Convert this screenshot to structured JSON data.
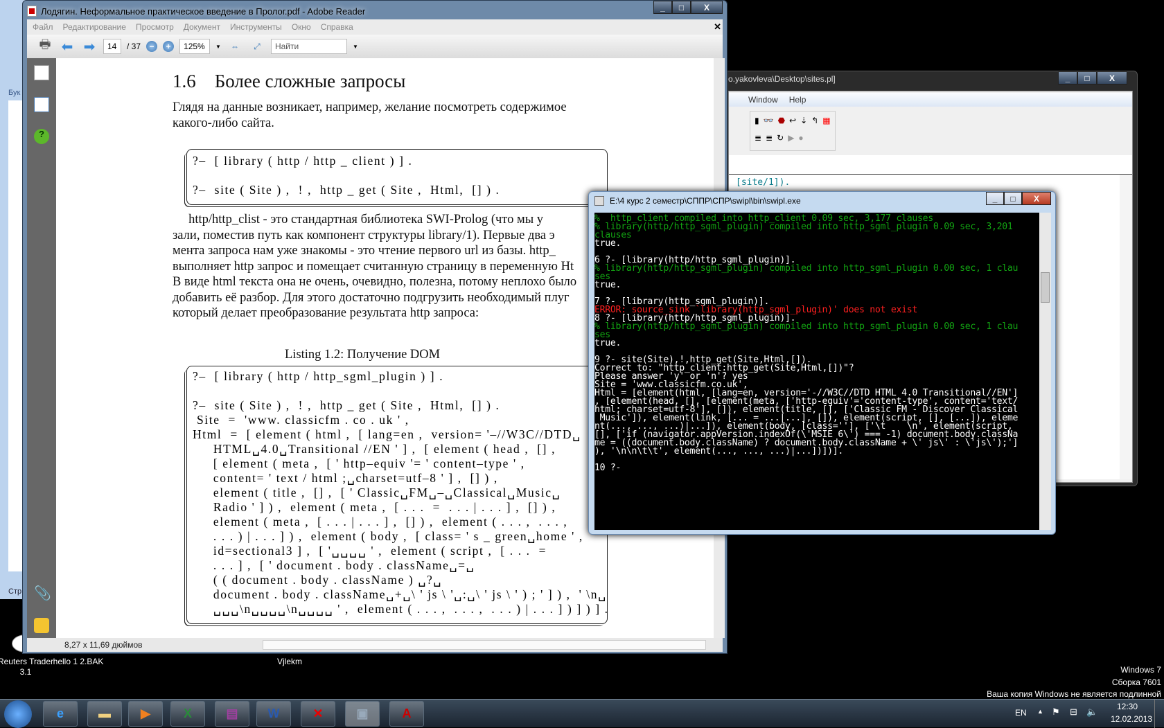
{
  "adobe": {
    "title": "Лодягин. Неформальное практическое введение в Пролог.pdf - Adobe Reader",
    "menu": [
      "Файл",
      "Редактирование",
      "Просмотр",
      "Документ",
      "Инструменты",
      "Окно",
      "Справка"
    ],
    "page": "14",
    "page_total": "/ 37",
    "zoom": "125%",
    "find_placeholder": "Найти",
    "status": "8,27 x 11,69 дюймов"
  },
  "pdf": {
    "heading": "1.6    Более сложные запросы",
    "para1": [
      "Глядя на данные возникает, например, желание посмотреть содержимое",
      "какого-либо сайта."
    ],
    "code1": [
      "?–  [ library ( http / http _ client ) ] .",
      "",
      "?–  site ( Site ) ,  ! ,  http _ get ( Site ,  Html,  [] ) ."
    ],
    "para2": [
      "     http/http_clist - это стандартная библиотека SWI-Prolog (что мы у",
      "зали, поместив путь как компонент структуры library/1). Первые два э",
      "мента запроса нам уже знакомы - это чтение первого url из базы. http_",
      "выполняет http запрос и помещает считанную страницу в переменную Ht",
      "В виде html текста она не очень, очевидно, полезна, потому неплохо было",
      "добавить её разбор. Для этого достаточно подгрузить необходимый плуг",
      "который делает преобразование результата http запроса:"
    ],
    "caption": "Listing 1.2: Получение DOM",
    "code2": [
      "?–  [ library ( http / http_sgml_plugin ) ] .",
      "",
      "?–  site ( Site ) ,  ! ,  http _ get ( Site ,  Html,  [] ) .",
      " Site  =  'www. classicfm . co . uk ' ,",
      "Html  =  [ element ( html ,  [ lang=en ,  version= '–//W3C//DTD␣",
      "     HTML␣4.0␣Transitional //EN ' ] ,  [ element ( head ,  [] ,",
      "     [ element ( meta ,  [ ' http–equiv '= ' content–type ' ,",
      "     content= ' text / html ;␣charset=utf–8 ' ] ,  [] ) ,",
      "     element ( title ,  [] ,  [ ' Classic␣FM␣–␣Classical␣Music␣",
      "     Radio ' ] ) ,  element ( meta ,  [ . . .  =  . . . | . . . ] ,  [] ) ,",
      "     element ( meta ,  [ . . . | . . . ] ,  [] ) ,  element ( . . . ,  . . . ,",
      "     . . . ) | . . . ] ) ,  element ( body ,  [ class= ' s _ green␣home ' ,",
      "     id=sectional3 ] ,  [ '␣␣␣␣ ' ,  element ( script ,  [ . . .  =",
      "     . . . ] ,  [ ' document . body . className␣=␣",
      "     ( ( document . body . className ) ␣?␣",
      "     document . body . className␣+␣\\ ' js \\ '␣:␣\\ ' js \\ ' ) ; ' ] ) ,  ' \\n␣",
      "     ␣␣␣\\n␣␣␣␣\\n␣␣␣␣ ' ,  element ( . . . ,  . . . ,  . . . ) | . . . ] ) ] ) ] ."
    ]
  },
  "swipl_bg": {
    "title": "o.yakovleva\\Desktop\\sites.pl]",
    "menu": [
      "Window",
      "Help"
    ],
    "code_fragment": "[site/1])."
  },
  "terminal": {
    "title": "E:\\4 курс 2 семестр\\СППР\\СПР\\swipl\\bin\\swipl.exe",
    "lines": [
      {
        "c": "g",
        "t": "%  http_client compiled into http_client 0.09 sec, 3,177 clauses"
      },
      {
        "c": "g",
        "t": "% library(http/http_sgml_plugin) compiled into http_sgml_plugin 0.09 sec, 3,201"
      },
      {
        "c": "g",
        "t": "clauses"
      },
      {
        "c": "w",
        "t": "true."
      },
      {
        "c": "w",
        "t": ""
      },
      {
        "c": "w",
        "t": "6 ?- [library(http/http_sgml_plugin)]."
      },
      {
        "c": "g",
        "t": "% library(http/http_sgml_plugin) compiled into http_sgml_plugin 0.00 sec, 1 clau"
      },
      {
        "c": "g",
        "t": "ses"
      },
      {
        "c": "w",
        "t": "true."
      },
      {
        "c": "w",
        "t": ""
      },
      {
        "c": "w",
        "t": "7 ?- [library(http_sgml_plugin)]."
      },
      {
        "c": "r",
        "t": "ERROR: source_sink `library(http_sgml_plugin)' does not exist"
      },
      {
        "c": "w",
        "t": "8 ?- [library(http/http_sgml_plugin)]."
      },
      {
        "c": "g",
        "t": "% library(http/http_sgml_plugin) compiled into http_sgml_plugin 0.00 sec, 1 clau"
      },
      {
        "c": "g",
        "t": "ses"
      },
      {
        "c": "w",
        "t": "true."
      },
      {
        "c": "w",
        "t": ""
      },
      {
        "c": "w",
        "t": "9 ?- site(Site),!,http_get(Site,Html,[])."
      },
      {
        "c": "w",
        "t": "Correct to: \"http_client:http_get(Site,Html,[])\"?"
      },
      {
        "c": "w",
        "t": "Please answer 'y' or 'n'? yes"
      },
      {
        "c": "w",
        "t": "Site = 'www.classicfm.co.uk',"
      },
      {
        "c": "w",
        "t": "Html = [element(html, [lang=en, version='-//W3C//DTD HTML 4.0 Transitional//EN']"
      },
      {
        "c": "w",
        "t": ", [element(head, [], [element(meta, ['http-equiv'='content-type', content='text/"
      },
      {
        "c": "w",
        "t": "html; charset=utf-8'], []), element(title, [], ['Classic FM - Discover Classical"
      },
      {
        "c": "w",
        "t": " Music']), element(link, [... = ...|...], []), element(script, [], [...]), eleme"
      },
      {
        "c": "w",
        "t": "nt(..., ..., ...)|...]), element(body, [class=''], ['\\t    \\n', element(script,"
      },
      {
        "c": "w",
        "t": "[], ['if (navigator.appVersion.indexOf(\\'MSIE 6\\') === -1) document.body.classNa"
      },
      {
        "c": "w",
        "t": "me = ((document.body.className) ? document.body.className + \\' js\\' : \\'js\\');']"
      },
      {
        "c": "w",
        "t": "), '\\n\\n\\t\\t', element(..., ..., ...)|...])])]."
      },
      {
        "c": "w",
        "t": ""
      },
      {
        "c": "w",
        "t": "10 ?-"
      }
    ]
  },
  "desktop": {
    "icons": [
      "Reuters Trader 3.1",
      "hello 1 2.BAK",
      "Vjlekm"
    ],
    "watermark": [
      "Windows 7",
      "Сборка 7601",
      "Ваша копия Windows не является подлинной"
    ]
  },
  "taskbar": {
    "lang": "EN",
    "time": "12:30",
    "date": "12.02.2013"
  },
  "bg_word": {
    "label1": "Бук",
    "label2": "Стр"
  }
}
